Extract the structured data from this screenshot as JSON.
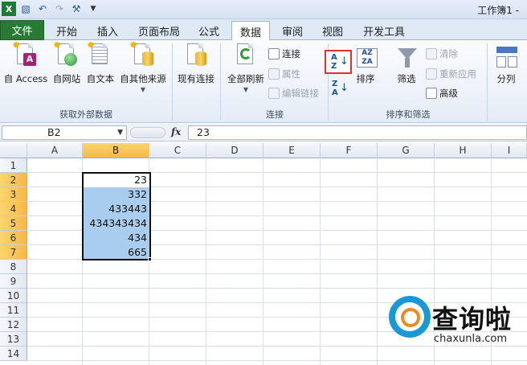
{
  "title_bar": {
    "title": "工作簿1 -"
  },
  "tabs": {
    "file": "文件",
    "items": [
      "开始",
      "插入",
      "页面布局",
      "公式",
      "数据",
      "审阅",
      "视图",
      "开发工具"
    ],
    "active": "数据"
  },
  "ribbon": {
    "get_external": {
      "label": "获取外部数据",
      "buttons": [
        "自 Access",
        "自网站",
        "自文本",
        "自其他来源",
        "现有连接"
      ]
    },
    "connections": {
      "label": "连接",
      "refresh_all": "全部刷新",
      "connect": "连接",
      "properties": "属性",
      "edit_links": "编辑链接"
    },
    "sort_filter": {
      "label": "排序和筛选",
      "sort_az": "A↓Z",
      "sort_za": "Z↓A",
      "sort": "排序",
      "filter": "筛选",
      "clear": "清除",
      "reapply": "重新应用",
      "advanced": "高级"
    },
    "data_tools": {
      "split": "分列"
    }
  },
  "formula_bar": {
    "name_box": "B2",
    "fx": "fx",
    "value": "23"
  },
  "grid": {
    "columns": [
      "A",
      "B",
      "C",
      "D",
      "E",
      "F",
      "G",
      "H",
      "I"
    ],
    "rows": [
      "1",
      "2",
      "3",
      "4",
      "5",
      "6",
      "7",
      "8",
      "9",
      "10",
      "11",
      "12",
      "13",
      "14"
    ],
    "b_values": [
      "23",
      "332",
      "433443",
      "434343434",
      "434",
      "665"
    ]
  },
  "watermark": {
    "brand": "查询啦",
    "site": "chaxunla.com"
  },
  "colors": {
    "file_tab": "#2a7a35",
    "selection_fill": "#a9cdef",
    "header_selected": "#f5b84a",
    "sort_highlight": "#e0302f"
  }
}
